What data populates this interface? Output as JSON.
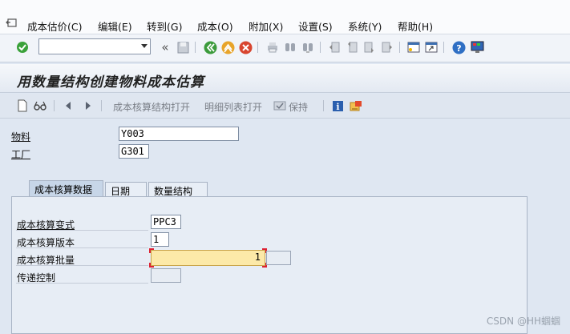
{
  "menubar": {
    "items": [
      "成本估价(C)",
      "编辑(E)",
      "转到(G)",
      "成本(O)",
      "附加(X)",
      "设置(S)",
      "系统(Y)",
      "帮助(H)"
    ]
  },
  "toolbar": {
    "command_field": "",
    "icons": [
      "enter-icon",
      "back-nav-icon",
      "save-icon",
      "back-icon",
      "exit-icon",
      "cancel-icon",
      "print-icon",
      "find-icon",
      "find-next-icon",
      "first-page-icon",
      "prev-page-icon",
      "next-page-icon",
      "last-page-icon",
      "create-session-icon",
      "shortcut-icon",
      "help-icon",
      "customize-layout-icon"
    ]
  },
  "page": {
    "title": "用数量结构创建物料成本估算"
  },
  "app_toolbar": {
    "costing_structure_open": "成本核算结构打开",
    "itemization_open": "明细列表打开",
    "keep": "保持"
  },
  "header_fields": {
    "material_label": "物料",
    "material_value": "Y003",
    "plant_label": "工厂",
    "plant_value": "G301"
  },
  "tabs": [
    {
      "label": "成本核算数据",
      "active": true
    },
    {
      "label": "日期",
      "active": false
    },
    {
      "label": "数量结构",
      "active": false
    }
  ],
  "costing_data": {
    "variant_label": "成本核算变式",
    "variant_value": "PPC3",
    "version_label": "成本核算版本",
    "version_value": "1",
    "lot_size_label": "成本核算批量",
    "lot_size_value": "1",
    "transfer_control_label": "传递控制",
    "transfer_control_value": ""
  },
  "watermark": "CSDN @HH蝈蝈"
}
